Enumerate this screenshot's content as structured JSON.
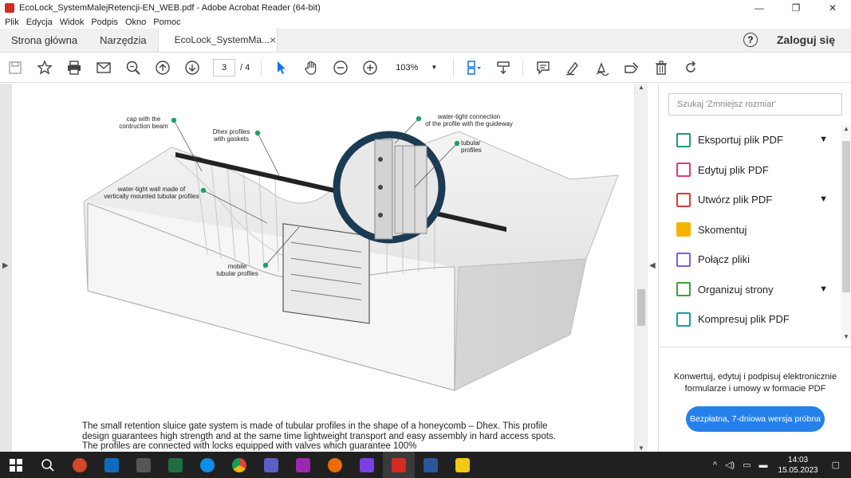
{
  "window": {
    "title": "EcoLock_SystemMalejRetencji-EN_WEB.pdf - Adobe Acrobat Reader (64-bit)",
    "controls": [
      "—",
      "❐",
      "✕"
    ]
  },
  "menu": [
    "Plik",
    "Edycja",
    "Widok",
    "Podpis",
    "Okno",
    "Pomoc"
  ],
  "tabs": {
    "home": "Strona główna",
    "tools": "Narzędzia",
    "doc": "EcoLock_SystemMa...",
    "close": "×",
    "help": "?",
    "login": "Zaloguj się"
  },
  "toolbar": {
    "page_current": "3",
    "page_total": "/ 4",
    "zoom": "103%"
  },
  "diagram_labels": {
    "cap": "cap with the\ncontruction beam",
    "dhex": "Dhex profiles\nwith gaskets",
    "wall": "water-tight wall made of\nvertically mounted tubular profiles",
    "mobile": "mobile\ntubular profiles",
    "connection": "water-tight connection\nof the profile with the guideway",
    "tubular": "tubular\nprofiles"
  },
  "body_text": "The small retention sluice gate system is made of tubular profiles in the shape of a honeycomb – Dhex. This profile design guarantees high strength and at the same time lightweight transport and easy assembly in hard access spots. The profiles are connected with locks equipped with valves which guarantee 100%",
  "panel": {
    "search_placeholder": "Szukaj 'Zmniejsz rozmiar'",
    "tools": [
      {
        "label": "Eksportuj plik PDF",
        "color": "#1b9e77",
        "chevron": true
      },
      {
        "label": "Edytuj plik PDF",
        "color": "#e5397a",
        "chevron": false
      },
      {
        "label": "Utwórz plik PDF",
        "color": "#e53935",
        "chevron": true
      },
      {
        "label": "Skomentuj",
        "color": "#f5b400",
        "chevron": false
      },
      {
        "label": "Połącz pliki",
        "color": "#7a5cf0",
        "chevron": false
      },
      {
        "label": "Organizuj strony",
        "color": "#3ca43c",
        "chevron": true
      },
      {
        "label": "Kompresuj plik PDF",
        "color": "#16a0a0",
        "chevron": false
      }
    ],
    "promo_text": "Konwertuj, edytuj i podpisuj elektronicznie formularze i umowy w formacie PDF",
    "promo_button": "Bezpłatna, 7-dniowa wersja próbna"
  },
  "taskbar": {
    "time": "14:03",
    "date": "15.05.2023",
    "apps": [
      {
        "name": "powerpoint",
        "color": "#d24726"
      },
      {
        "name": "outlook",
        "color": "#0f6cbd"
      },
      {
        "name": "app-dark",
        "color": "#444444"
      },
      {
        "name": "excel",
        "color": "#1d6f42"
      },
      {
        "name": "teamviewer",
        "color": "#0e8ee9"
      },
      {
        "name": "chrome",
        "color": "#e8b400"
      },
      {
        "name": "teams",
        "color": "#5b5fc7"
      },
      {
        "name": "clip",
        "color": "#9c27b0"
      },
      {
        "name": "anydesk",
        "color": "#ef6c00"
      },
      {
        "name": "clipchamp",
        "color": "#7b3fe4"
      },
      {
        "name": "acrobat",
        "color": "#d42a22"
      },
      {
        "name": "word",
        "color": "#2b579a"
      },
      {
        "name": "explorer",
        "color": "#f2c811"
      }
    ]
  }
}
